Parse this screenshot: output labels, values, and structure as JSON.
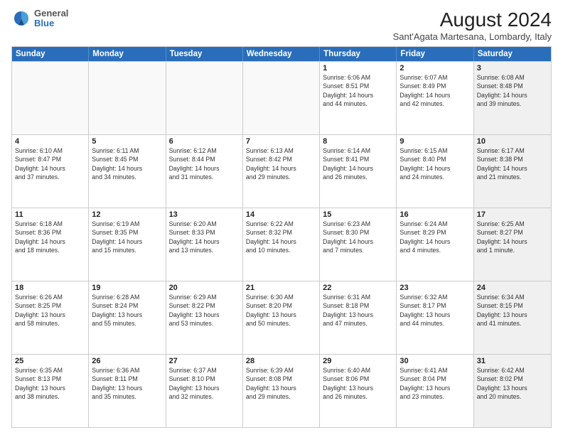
{
  "logo": {
    "general": "General",
    "blue": "Blue"
  },
  "title": "August 2024",
  "subtitle": "Sant'Agata Martesana, Lombardy, Italy",
  "headers": [
    "Sunday",
    "Monday",
    "Tuesday",
    "Wednesday",
    "Thursday",
    "Friday",
    "Saturday"
  ],
  "weeks": [
    [
      {
        "day": "",
        "info": ""
      },
      {
        "day": "",
        "info": ""
      },
      {
        "day": "",
        "info": ""
      },
      {
        "day": "",
        "info": ""
      },
      {
        "day": "1",
        "info": "Sunrise: 6:06 AM\nSunset: 8:51 PM\nDaylight: 14 hours\nand 44 minutes."
      },
      {
        "day": "2",
        "info": "Sunrise: 6:07 AM\nSunset: 8:49 PM\nDaylight: 14 hours\nand 42 minutes."
      },
      {
        "day": "3",
        "info": "Sunrise: 6:08 AM\nSunset: 8:48 PM\nDaylight: 14 hours\nand 39 minutes."
      }
    ],
    [
      {
        "day": "4",
        "info": "Sunrise: 6:10 AM\nSunset: 8:47 PM\nDaylight: 14 hours\nand 37 minutes."
      },
      {
        "day": "5",
        "info": "Sunrise: 6:11 AM\nSunset: 8:45 PM\nDaylight: 14 hours\nand 34 minutes."
      },
      {
        "day": "6",
        "info": "Sunrise: 6:12 AM\nSunset: 8:44 PM\nDaylight: 14 hours\nand 31 minutes."
      },
      {
        "day": "7",
        "info": "Sunrise: 6:13 AM\nSunset: 8:42 PM\nDaylight: 14 hours\nand 29 minutes."
      },
      {
        "day": "8",
        "info": "Sunrise: 6:14 AM\nSunset: 8:41 PM\nDaylight: 14 hours\nand 26 minutes."
      },
      {
        "day": "9",
        "info": "Sunrise: 6:15 AM\nSunset: 8:40 PM\nDaylight: 14 hours\nand 24 minutes."
      },
      {
        "day": "10",
        "info": "Sunrise: 6:17 AM\nSunset: 8:38 PM\nDaylight: 14 hours\nand 21 minutes."
      }
    ],
    [
      {
        "day": "11",
        "info": "Sunrise: 6:18 AM\nSunset: 8:36 PM\nDaylight: 14 hours\nand 18 minutes."
      },
      {
        "day": "12",
        "info": "Sunrise: 6:19 AM\nSunset: 8:35 PM\nDaylight: 14 hours\nand 15 minutes."
      },
      {
        "day": "13",
        "info": "Sunrise: 6:20 AM\nSunset: 8:33 PM\nDaylight: 14 hours\nand 13 minutes."
      },
      {
        "day": "14",
        "info": "Sunrise: 6:22 AM\nSunset: 8:32 PM\nDaylight: 14 hours\nand 10 minutes."
      },
      {
        "day": "15",
        "info": "Sunrise: 6:23 AM\nSunset: 8:30 PM\nDaylight: 14 hours\nand 7 minutes."
      },
      {
        "day": "16",
        "info": "Sunrise: 6:24 AM\nSunset: 8:29 PM\nDaylight: 14 hours\nand 4 minutes."
      },
      {
        "day": "17",
        "info": "Sunrise: 6:25 AM\nSunset: 8:27 PM\nDaylight: 14 hours\nand 1 minute."
      }
    ],
    [
      {
        "day": "18",
        "info": "Sunrise: 6:26 AM\nSunset: 8:25 PM\nDaylight: 13 hours\nand 58 minutes."
      },
      {
        "day": "19",
        "info": "Sunrise: 6:28 AM\nSunset: 8:24 PM\nDaylight: 13 hours\nand 55 minutes."
      },
      {
        "day": "20",
        "info": "Sunrise: 6:29 AM\nSunset: 8:22 PM\nDaylight: 13 hours\nand 53 minutes."
      },
      {
        "day": "21",
        "info": "Sunrise: 6:30 AM\nSunset: 8:20 PM\nDaylight: 13 hours\nand 50 minutes."
      },
      {
        "day": "22",
        "info": "Sunrise: 6:31 AM\nSunset: 8:18 PM\nDaylight: 13 hours\nand 47 minutes."
      },
      {
        "day": "23",
        "info": "Sunrise: 6:32 AM\nSunset: 8:17 PM\nDaylight: 13 hours\nand 44 minutes."
      },
      {
        "day": "24",
        "info": "Sunrise: 6:34 AM\nSunset: 8:15 PM\nDaylight: 13 hours\nand 41 minutes."
      }
    ],
    [
      {
        "day": "25",
        "info": "Sunrise: 6:35 AM\nSunset: 8:13 PM\nDaylight: 13 hours\nand 38 minutes."
      },
      {
        "day": "26",
        "info": "Sunrise: 6:36 AM\nSunset: 8:11 PM\nDaylight: 13 hours\nand 35 minutes."
      },
      {
        "day": "27",
        "info": "Sunrise: 6:37 AM\nSunset: 8:10 PM\nDaylight: 13 hours\nand 32 minutes."
      },
      {
        "day": "28",
        "info": "Sunrise: 6:39 AM\nSunset: 8:08 PM\nDaylight: 13 hours\nand 29 minutes."
      },
      {
        "day": "29",
        "info": "Sunrise: 6:40 AM\nSunset: 8:06 PM\nDaylight: 13 hours\nand 26 minutes."
      },
      {
        "day": "30",
        "info": "Sunrise: 6:41 AM\nSunset: 8:04 PM\nDaylight: 13 hours\nand 23 minutes."
      },
      {
        "day": "31",
        "info": "Sunrise: 6:42 AM\nSunset: 8:02 PM\nDaylight: 13 hours\nand 20 minutes."
      }
    ]
  ]
}
